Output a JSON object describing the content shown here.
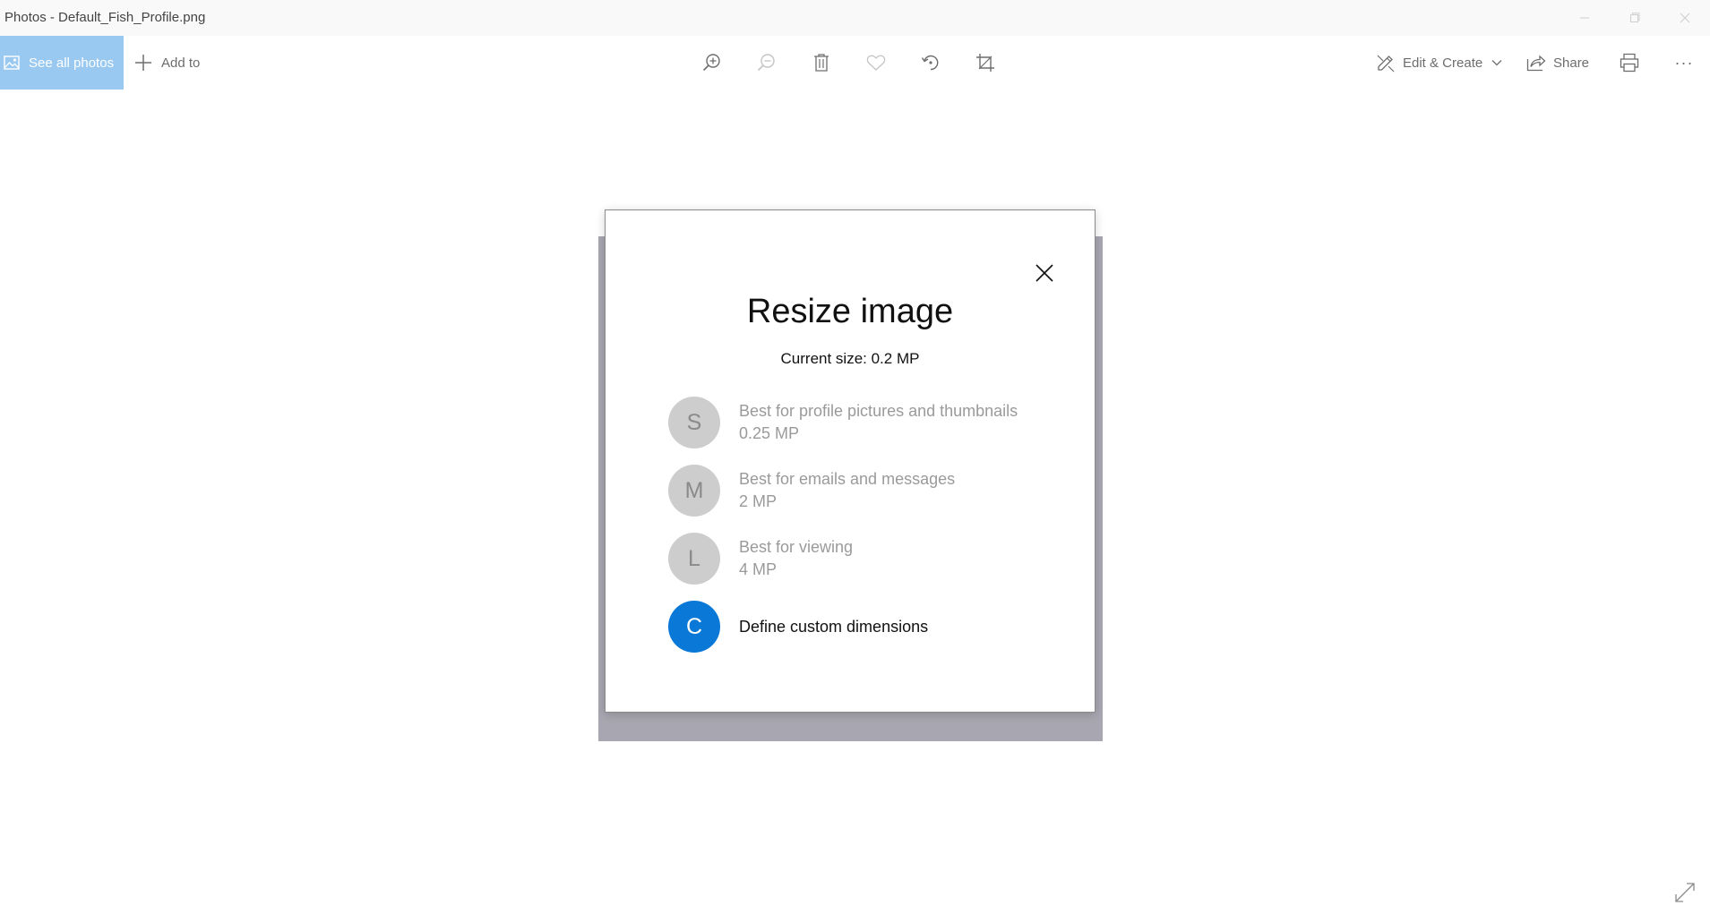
{
  "window": {
    "title": "Photos - Default_Fish_Profile.png"
  },
  "toolbar": {
    "see_all_label": "See all photos",
    "add_to_label": "Add to",
    "edit_create_label": "Edit & Create",
    "share_label": "Share",
    "more_label": "···",
    "icons": [
      "zoom-in-icon",
      "zoom-out-icon",
      "delete-icon",
      "heart-icon",
      "rotate-icon",
      "crop-icon",
      "print-icon"
    ]
  },
  "dialog": {
    "title": "Resize image",
    "current_size": "Current size: 0.2 MP",
    "options": [
      {
        "letter": "S",
        "line1": "Best for profile pictures and thumbnails",
        "line2": "0.25 MP"
      },
      {
        "letter": "M",
        "line1": "Best for emails and messages",
        "line2": "2 MP"
      },
      {
        "letter": "L",
        "line1": "Best for viewing",
        "line2": "4 MP"
      },
      {
        "letter": "C",
        "line1": "Define custom dimensions"
      }
    ]
  },
  "colors": {
    "accent": "#0a78d7",
    "see_all_bg": "#99c9f1",
    "disabled_circle": "#cdcdcd"
  }
}
